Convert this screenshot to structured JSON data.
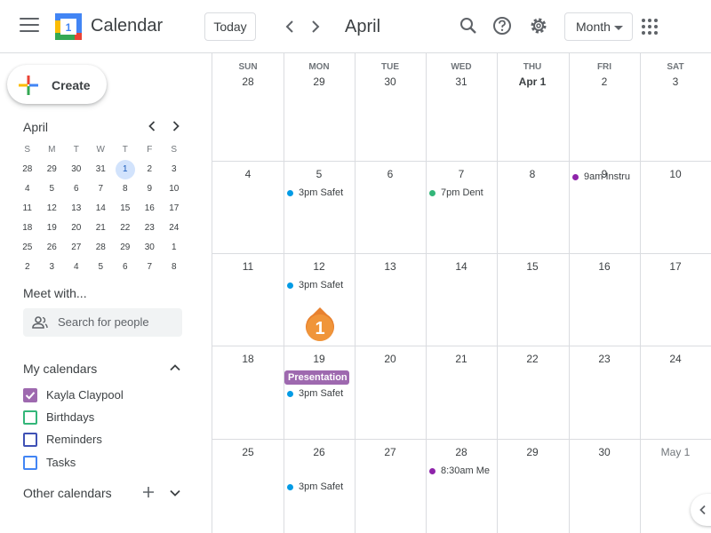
{
  "header": {
    "app_title": "Calendar",
    "logo_day": "1",
    "today_label": "Today",
    "month_title": "April",
    "view_label": "Month"
  },
  "colors": {
    "blue": "#1a73e8",
    "cyan": "#039be5",
    "teal": "#33b679",
    "purple": "#8e24aa",
    "lavender": "#9e69af"
  },
  "icons": [
    "menu-icon",
    "calendar-logo",
    "chevron-left-icon",
    "chevron-right-icon",
    "search-icon",
    "help-icon",
    "gear-icon",
    "caret-down-icon",
    "apps-icon",
    "people-icon",
    "chevron-up-icon",
    "chevron-down-icon",
    "plus-icon"
  ],
  "sidebar": {
    "create_label": "Create",
    "mini_month": "April",
    "mini_dow": [
      "S",
      "M",
      "T",
      "W",
      "T",
      "F",
      "S"
    ],
    "mini_weeks": [
      [
        "28",
        "29",
        "30",
        "31",
        "1",
        "2",
        "3"
      ],
      [
        "4",
        "5",
        "6",
        "7",
        "8",
        "9",
        "10"
      ],
      [
        "11",
        "12",
        "13",
        "14",
        "15",
        "16",
        "17"
      ],
      [
        "18",
        "19",
        "20",
        "21",
        "22",
        "23",
        "24"
      ],
      [
        "25",
        "26",
        "27",
        "28",
        "29",
        "30",
        "1"
      ],
      [
        "2",
        "3",
        "4",
        "5",
        "6",
        "7",
        "8"
      ]
    ],
    "meet_title": "Meet with...",
    "people_placeholder": "Search for people",
    "my_calendars_title": "My calendars",
    "my_calendars": [
      {
        "name": "Kayla Claypool",
        "checked": true,
        "color": "#9e69af"
      },
      {
        "name": "Birthdays",
        "checked": false,
        "color": "#33b679"
      },
      {
        "name": "Reminders",
        "checked": false,
        "color": "#3f51b5"
      },
      {
        "name": "Tasks",
        "checked": false,
        "color": "#4285f4"
      }
    ],
    "other_calendars_title": "Other calendars"
  },
  "grid": {
    "dow": [
      "SUN",
      "MON",
      "TUE",
      "WED",
      "THU",
      "FRI",
      "SAT"
    ],
    "weeks": [
      [
        "28",
        "29",
        "30",
        "31",
        "Apr 1",
        "2",
        "3"
      ],
      [
        "4",
        "5",
        "6",
        "7",
        "8",
        "9",
        "10"
      ],
      [
        "11",
        "12",
        "13",
        "14",
        "15",
        "16",
        "17"
      ],
      [
        "18",
        "19",
        "20",
        "21",
        "22",
        "23",
        "24"
      ],
      [
        "25",
        "26",
        "27",
        "28",
        "29",
        "30",
        "May 1"
      ]
    ],
    "events": [
      {
        "week": 1,
        "day": 1,
        "text": "3pm Safet",
        "color": "#039be5",
        "row": 0
      },
      {
        "week": 1,
        "day": 3,
        "text": "7pm Dent",
        "color": "#33b679",
        "row": 0
      },
      {
        "week": 1,
        "day": 5,
        "text": "9am Instru",
        "color": "#8e24aa",
        "row": -1
      },
      {
        "week": 2,
        "day": 1,
        "text": "3pm Safet",
        "color": "#039be5",
        "row": 0
      },
      {
        "week": 3,
        "day": 1,
        "text": "3pm Safet",
        "color": "#039be5",
        "row": 1
      },
      {
        "week": 4,
        "day": 1,
        "text": "3pm Safet",
        "color": "#039be5",
        "row": 1
      },
      {
        "week": 4,
        "day": 3,
        "text": "8:30am Me",
        "color": "#8e24aa",
        "row": 0
      }
    ],
    "chips": [
      {
        "week": 3,
        "day": 1,
        "text": "Presentation",
        "color": "#9e69af"
      }
    ],
    "callout_label": "1"
  }
}
